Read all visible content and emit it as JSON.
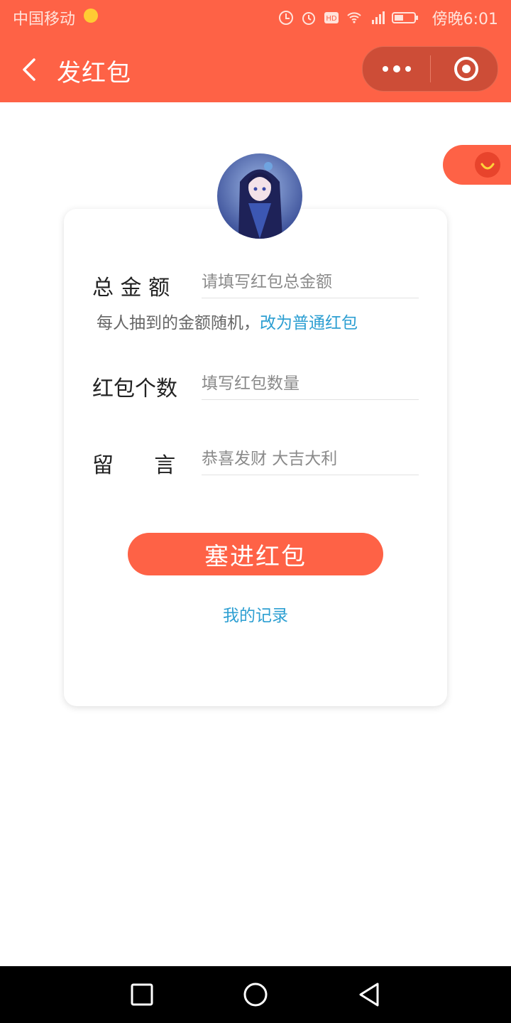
{
  "status_bar": {
    "carrier": "中国移动",
    "time": "傍晚6:01",
    "icons": [
      "data-saver-icon",
      "alarm-icon",
      "hd-icon",
      "wifi-icon",
      "4g-signal-icon",
      "battery-icon"
    ]
  },
  "nav": {
    "title": "发红包",
    "back_icon": "chevron-left-icon",
    "more_icon": "more-dots-icon",
    "close_icon": "target-close-icon"
  },
  "form": {
    "total_amount": {
      "label": "总 金 额",
      "placeholder": "请填写红包总金额",
      "value": ""
    },
    "hint_text": "每人抽到的金额随机，",
    "hint_link": "改为普通红包",
    "count": {
      "label": "红包个数",
      "placeholder": "填写红包数量",
      "value": ""
    },
    "message": {
      "label": "留      言",
      "placeholder": "恭喜发财 大吉大利",
      "value": ""
    },
    "submit_label": "塞进红包",
    "records_link": "我的记录"
  },
  "colors": {
    "brand": "#fe6246",
    "link": "#2d9fd2",
    "capsule": "#cd4d37"
  }
}
